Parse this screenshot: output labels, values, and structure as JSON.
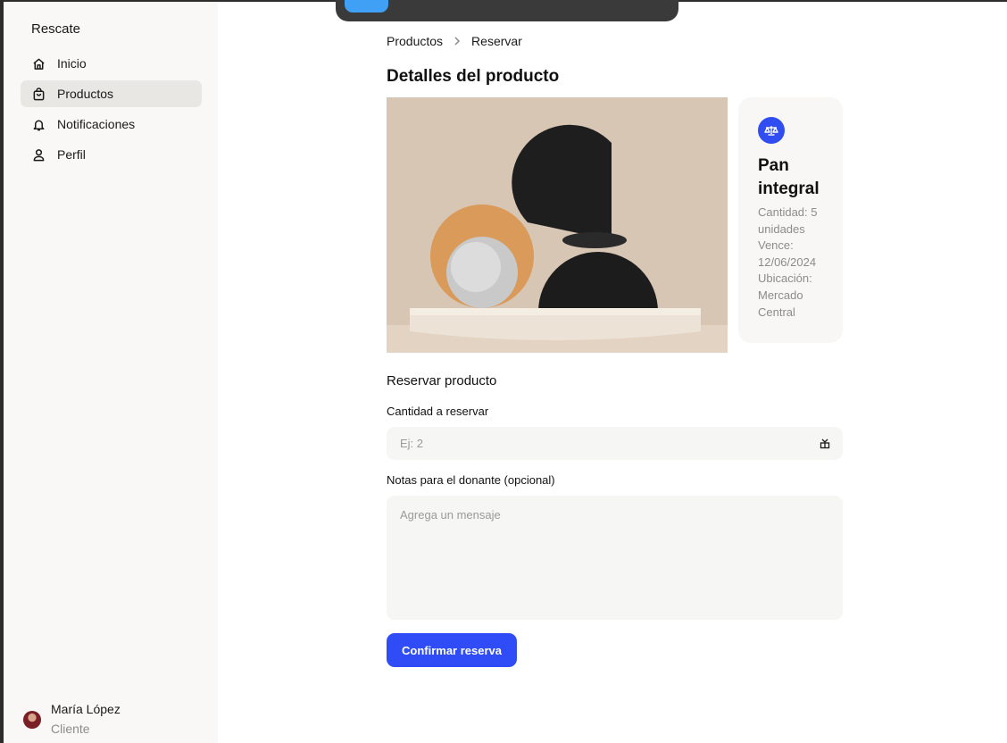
{
  "sidebar": {
    "app_name": "Rescate",
    "items": [
      {
        "label": "Inicio",
        "icon": "home-icon"
      },
      {
        "label": "Productos",
        "icon": "shopping-bag-icon",
        "active": true
      },
      {
        "label": "Notificaciones",
        "icon": "bell-icon"
      },
      {
        "label": "Perfil",
        "icon": "user-icon"
      }
    ],
    "user": {
      "name": "María López",
      "role": "Cliente"
    }
  },
  "breadcrumb": {
    "items": [
      "Productos",
      "Reservar"
    ]
  },
  "page_title": "Detalles del producto",
  "product": {
    "image_alt": "abstract-shapes-photo",
    "badge_icon": "scale-icon",
    "name": "Pan integral",
    "details": "Cantidad: 5 unidades Vence: 12/06/2024 Ubicación: Mercado Central"
  },
  "form": {
    "section_title": "Reservar producto",
    "quantity_label": "Cantidad a reservar",
    "quantity_placeholder": "Ej: 2",
    "quantity_icon": "stepper-icon",
    "notes_label": "Notas para el donante (opcional)",
    "notes_placeholder": "Agrega un mensaje",
    "submit_label": "Confirmar reserva"
  },
  "colors": {
    "accent": "#2f4cf6",
    "sidebar_bg": "#f9f8f6",
    "input_bg": "#f6f6f4",
    "active_nav_bg": "#e9e7e4",
    "topbar_bg": "#3a3a3a",
    "topbar_button": "#3fa0f5"
  }
}
